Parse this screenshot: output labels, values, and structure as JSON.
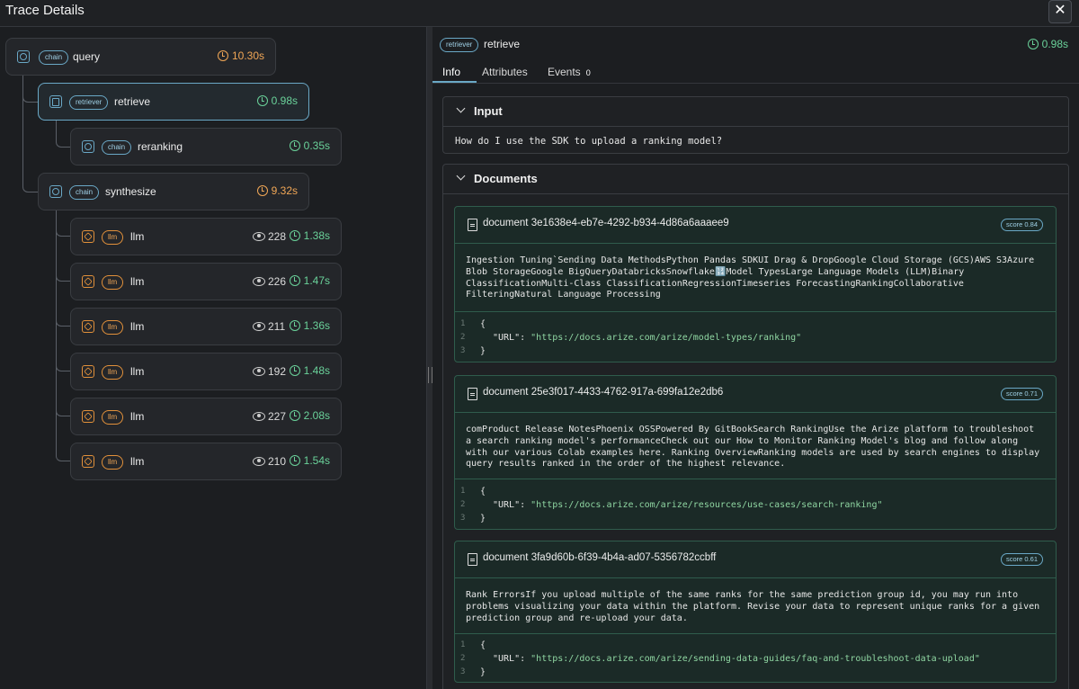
{
  "window": {
    "title": "Trace Details",
    "close_glyph": "✕"
  },
  "tree": [
    {
      "kind": "chain",
      "name": "query",
      "latency": "10.30s",
      "latency_color": "orange"
    },
    {
      "kind": "retriever",
      "name": "retrieve",
      "latency": "0.98s",
      "latency_color": "green",
      "selected": true
    },
    {
      "kind": "chain",
      "name": "reranking",
      "latency": "0.35s",
      "latency_color": "green"
    },
    {
      "kind": "chain",
      "name": "synthesize",
      "latency": "9.32s",
      "latency_color": "orange"
    },
    {
      "kind": "llm",
      "name": "llm",
      "tokens": "228",
      "latency": "1.38s",
      "latency_color": "green"
    },
    {
      "kind": "llm",
      "name": "llm",
      "tokens": "226",
      "latency": "1.47s",
      "latency_color": "green"
    },
    {
      "kind": "llm",
      "name": "llm",
      "tokens": "211",
      "latency": "1.36s",
      "latency_color": "green"
    },
    {
      "kind": "llm",
      "name": "llm",
      "tokens": "192",
      "latency": "1.48s",
      "latency_color": "green"
    },
    {
      "kind": "llm",
      "name": "llm",
      "tokens": "227",
      "latency": "2.08s",
      "latency_color": "green"
    },
    {
      "kind": "llm",
      "name": "llm",
      "tokens": "210",
      "latency": "1.54s",
      "latency_color": "green"
    }
  ],
  "detail": {
    "kind": "retriever",
    "name": "retrieve",
    "latency": "0.98s",
    "tabs": [
      {
        "label": "Info",
        "active": true
      },
      {
        "label": "Attributes"
      },
      {
        "label": "Events",
        "count": "0"
      }
    ],
    "input": {
      "label": "Input",
      "text": "How do I use the SDK to upload a ranking model?"
    },
    "documents": {
      "label": "Documents",
      "items": [
        {
          "title": "document 3e1638e4-eb7e-4292-b934-4d86a6aaaee9",
          "score": "score 0.84",
          "content": "Ingestion Tuning`Sending Data MethodsPython Pandas SDKUI Drag & DropGoogle Cloud Storage (GCS)AWS S3Azure Blob StorageGoogle BigQueryDatabricksSnowflake🔢Model TypesLarge Language Models (LLM)Binary ClassificationMulti-Class ClassificationRegressionTimeseries ForecastingRankingCollaborative FilteringNatural Language Processing",
          "code": [
            {
              "ln": "1",
              "text": "{"
            },
            {
              "ln": "2",
              "key": "\"URL\"",
              "value": "\"https://docs.arize.com/arize/model-types/ranking\""
            },
            {
              "ln": "3",
              "text": "}"
            }
          ]
        },
        {
          "title": "document 25e3f017-4433-4762-917a-699fa12e2db6",
          "score": "score 0.71",
          "content": "comProduct Release NotesPhoenix OSSPowered By GitBookSearch RankingUse the Arize platform to troubleshoot a search ranking model's performanceCheck out our How to Monitor Ranking Model's blog and follow along with our various Colab examples here. Ranking OverviewRanking models are used by search engines to display query results ranked in the order of the highest relevance.",
          "code": [
            {
              "ln": "1",
              "text": "{"
            },
            {
              "ln": "2",
              "key": "\"URL\"",
              "value": "\"https://docs.arize.com/arize/resources/use-cases/search-ranking\""
            },
            {
              "ln": "3",
              "text": "}"
            }
          ]
        },
        {
          "title": "document 3fa9d60b-6f39-4b4a-ad07-5356782ccbff",
          "score": "score 0.61",
          "content": "Rank ErrorsIf you upload multiple of the same ranks for the same prediction group id, you may run into problems visualizing your data within the platform. Revise your data to represent unique ranks for a given prediction group and re-upload your data.",
          "code": [
            {
              "ln": "1",
              "text": "{"
            },
            {
              "ln": "2",
              "key": "\"URL\"",
              "value": "\"https://docs.arize.com/arize/sending-data-guides/faq-and-troubleshoot-data-upload\""
            },
            {
              "ln": "3",
              "text": "}"
            }
          ]
        }
      ]
    }
  }
}
